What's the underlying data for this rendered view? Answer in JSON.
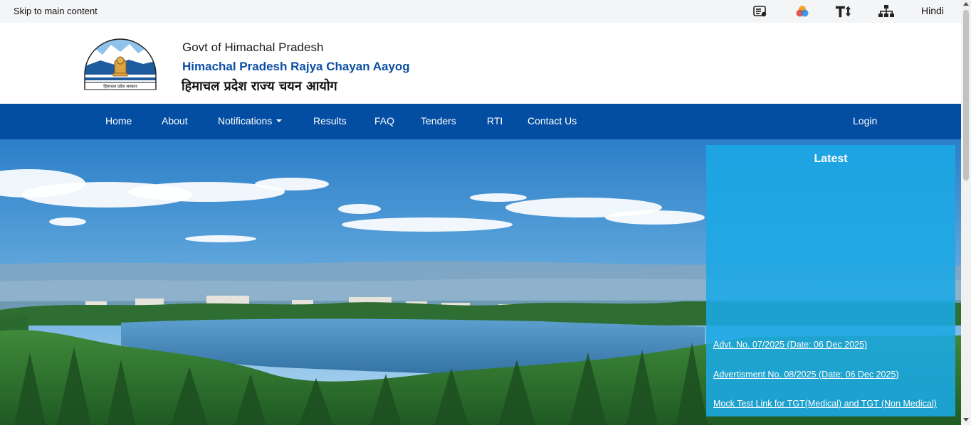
{
  "topbar": {
    "skip_link": "Skip to main content",
    "icons": [
      "screen-reader-icon",
      "color-contrast-icon",
      "text-size-icon",
      "sitemap-icon"
    ],
    "language_link": "Hindi"
  },
  "header": {
    "govt_name": "Govt of Himachal Pradesh",
    "org_name_english": "Himachal Pradesh Rajya Chayan Aayog",
    "org_name_hindi": "हिमाचल प्रदेश राज्य चयन आयोग",
    "emblem_text": "हिमाचल प्रदेश सरकार"
  },
  "nav": {
    "items": [
      "Home",
      "About",
      "Notifications",
      "Results",
      "FAQ",
      "Tenders",
      "RTI",
      "Contact Us"
    ],
    "login": "Login"
  },
  "latest": {
    "title": "Latest",
    "items": [
      "Advt. No. 07/2025 (Date: 06 Dec 2025)",
      "Advertisment No. 08/2025 (Date: 06 Dec 2025)",
      "Mock Test Link for TGT(Medical) and TGT (Non Medical)"
    ]
  },
  "colors": {
    "nav_background": "#034ea2",
    "org_title": "#0a4fa3",
    "latest_panel": "#1ba8e5"
  }
}
